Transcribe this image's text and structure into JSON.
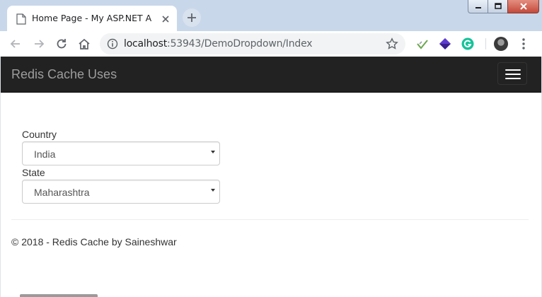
{
  "browser": {
    "tab": {
      "title": "Home Page - My ASP.NET Applic",
      "favicon": "document-icon"
    },
    "window_controls": [
      "minimize",
      "maximize",
      "close"
    ],
    "address": {
      "host": "localhost",
      "rest": ":53943/DemoDropdown/Index"
    },
    "extensions": [
      "feedly-icon",
      "ext-cube-icon",
      "grammarly-icon"
    ]
  },
  "app": {
    "brand": "Redis Cache Uses",
    "form": {
      "country_label": "Country",
      "country_value": "India",
      "state_label": "State",
      "state_value": "Maharashtra"
    },
    "footer": "© 2018 - Redis Cache by Saineshwar"
  },
  "colors": {
    "navbar": "#222222",
    "brand_text": "#9d9d9d",
    "chrome_frame": "#c9d7ea"
  }
}
